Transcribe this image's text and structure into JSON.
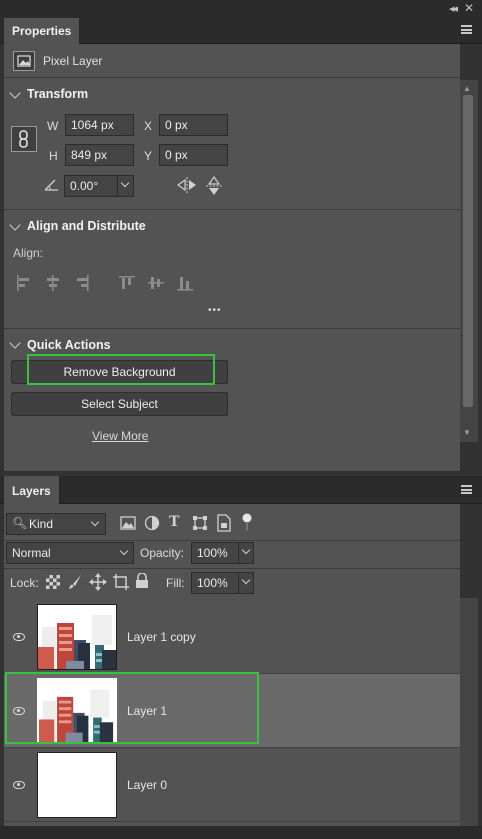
{
  "properties": {
    "tab": "Properties",
    "layer_kind": "Pixel Layer",
    "transform": {
      "title": "Transform",
      "w_label": "W",
      "w_value": "1064 px",
      "h_label": "H",
      "h_value": "849 px",
      "x_label": "X",
      "x_value": "0 px",
      "y_label": "Y",
      "y_value": "0 px",
      "angle_value": "0.00°"
    },
    "align": {
      "title": "Align and Distribute",
      "label": "Align:",
      "more": "•••"
    },
    "quick_actions": {
      "title": "Quick Actions",
      "remove_bg": "Remove Background",
      "select_subject": "Select Subject",
      "view_more": "View More"
    }
  },
  "layers": {
    "tab": "Layers",
    "filter_kind": "Kind",
    "blend_mode": "Normal",
    "opacity_label": "Opacity:",
    "opacity_value": "100%",
    "lock_label": "Lock:",
    "fill_label": "Fill:",
    "fill_value": "100%",
    "items": [
      {
        "name": "Layer 1 copy",
        "selected": false
      },
      {
        "name": "Layer 1",
        "selected": true
      },
      {
        "name": "Layer 0",
        "selected": false
      }
    ]
  },
  "colors": {
    "highlight": "#34c33a",
    "panel_bg": "#535353",
    "selected_row": "#6a6a6a"
  }
}
